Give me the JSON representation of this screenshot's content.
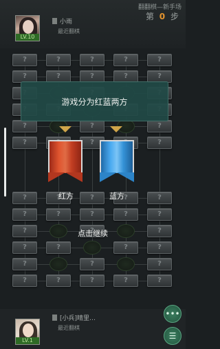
{
  "header": {
    "mode_title": "翻翻棋—新手场",
    "turn_prefix": "第",
    "turn_number": "0",
    "turn_suffix": "步"
  },
  "opponent": {
    "name": "小雨",
    "subtitle": "最近翻棋",
    "level": "LV.10"
  },
  "player": {
    "name": "[小兵]晴里…",
    "subtitle": "最近翻棋",
    "level": "LV.1"
  },
  "board": {
    "hidden_piece": "?"
  },
  "tutorial": {
    "banner_text": "游戏分为红蓝两方",
    "red_label": "红方",
    "blue_label": "蓝方",
    "continue_text": "点击继续"
  },
  "buttons": {
    "chat_icon": "more-icon",
    "menu_icon": "menu-icon",
    "chat_glyph": "•••",
    "menu_glyph": "☰"
  },
  "colors": {
    "red": "#d0442a",
    "blue": "#3a9be0",
    "accent": "#e3932e",
    "banner": "#214a46"
  }
}
